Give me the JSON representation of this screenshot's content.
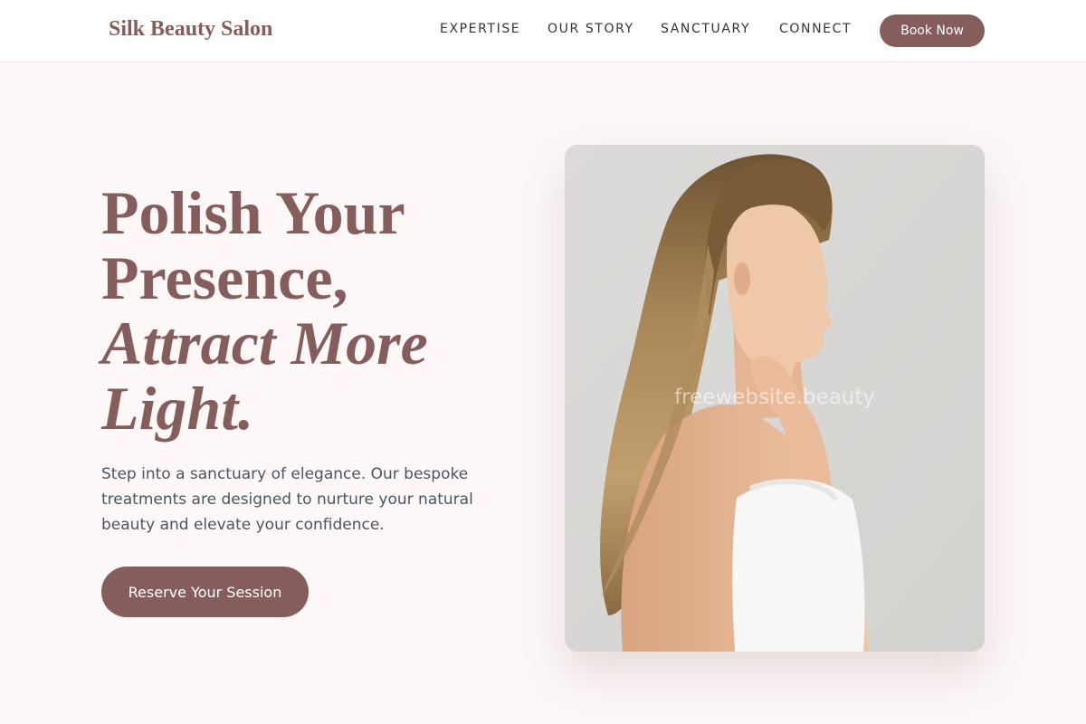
{
  "header": {
    "logo": "Silk Beauty Salon",
    "nav": [
      "EXPERTISE",
      "OUR STORY",
      "SANCTUARY",
      "CONNECT"
    ],
    "cta": "Book Now"
  },
  "hero": {
    "title_line1": "Polish Your",
    "title_line2": "Presence,",
    "title_line3": "Attract More",
    "title_line4": "Light.",
    "description": "Step into a sanctuary of elegance. Our bespoke treatments are designed to nurture your natural beauty and elevate your confidence.",
    "cta": "Reserve Your Session"
  },
  "image": {
    "watermark": "freewebsite.beauty"
  },
  "colors": {
    "brand": "#855d5d",
    "background": "#fdf7f7",
    "body_text": "#4b5563"
  }
}
